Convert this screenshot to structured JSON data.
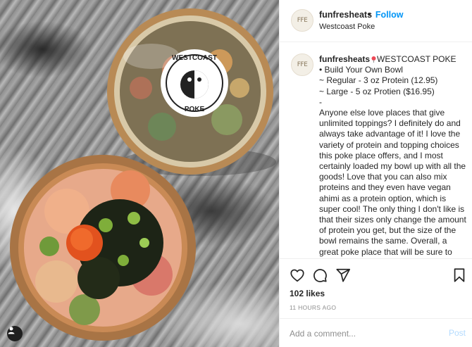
{
  "post": {
    "username": "funfresheats",
    "follow_separator": "•",
    "follow_label": "Follow",
    "location": "Westcoast Poke",
    "avatar_mark": "FFE",
    "photo_logo_line1": "WESTCOAST",
    "photo_logo_line2": "POKE"
  },
  "caption": {
    "username": "funfresheats",
    "title": "WESTCOAST POKE",
    "lines": [
      "• Build Your Own Bowl",
      "~ Regular - 3 oz Protein (12.95)",
      "~ Large - 5 oz Protien ($16.95)",
      "-"
    ],
    "body": "Anyone else love places that give unlimited toppings? I definitely do and always take advantage of it! I love the variety of protein and topping choices this poke place offers, and I most certainly loaded my bowl up with all the goods! Love that you can also mix proteins and they even have vegan ahimi as a protein option, which is super cool! The only thing I don't like is that their sizes only change the amount of protein you get, but the size of the bowl remains the same. Overall, a great poke place that will be sure to have something for everyone!"
  },
  "actions": {
    "icons": [
      "heart-icon",
      "comment-icon",
      "share-icon",
      "bookmark-icon"
    ]
  },
  "stats": {
    "likes": "102 likes",
    "timestamp": "11 HOURS AGO"
  },
  "comment": {
    "placeholder": "Add a comment...",
    "post_label": "Post"
  },
  "colors": {
    "accent": "#0095f6",
    "post_disabled": "#b3dbff",
    "pin": "#ed4956"
  }
}
